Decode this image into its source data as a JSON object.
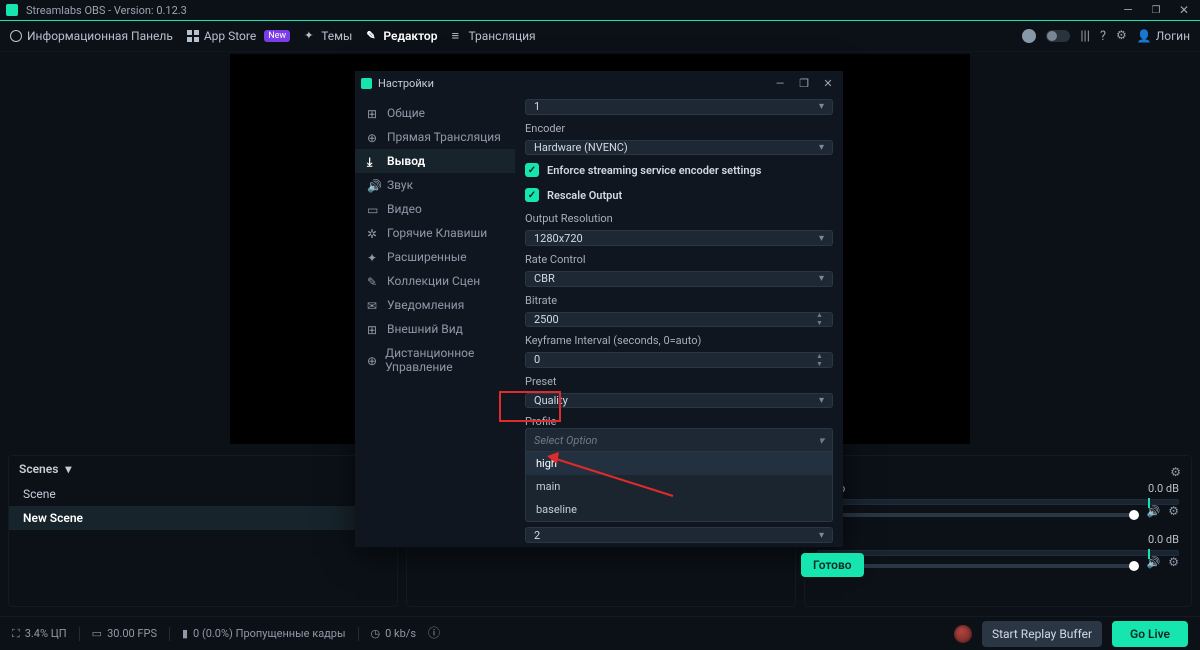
{
  "titlebar": {
    "app_name": "Streamlabs OBS - Version: 0.12.3"
  },
  "topnav": {
    "items": [
      {
        "label": "Информационная Панель",
        "icon": "dashboard-icon"
      },
      {
        "label": "App Store",
        "icon": "appstore-icon",
        "badge": "New"
      },
      {
        "label": "Темы",
        "icon": "themes-icon"
      },
      {
        "label": "Редактор",
        "icon": "editor-icon",
        "active": true
      },
      {
        "label": "Трансляция",
        "icon": "broadcast-icon"
      }
    ],
    "right": {
      "login": "Логин"
    }
  },
  "settings": {
    "title": "Настройки",
    "sidebar": [
      {
        "label": "Общие",
        "icon": "general-icon"
      },
      {
        "label": "Прямая Трансляция",
        "icon": "stream-icon"
      },
      {
        "label": "Вывод",
        "icon": "output-icon",
        "active": true
      },
      {
        "label": "Звук",
        "icon": "audio-icon"
      },
      {
        "label": "Видео",
        "icon": "video-icon"
      },
      {
        "label": "Горячие Клавиши",
        "icon": "hotkeys-icon"
      },
      {
        "label": "Расширенные",
        "icon": "advanced-icon"
      },
      {
        "label": "Коллекции Сцен",
        "icon": "collections-icon"
      },
      {
        "label": "Уведомления",
        "icon": "notifications-icon"
      },
      {
        "label": "Внешний Вид",
        "icon": "appearance-icon"
      },
      {
        "label": "Дистанционное Управление",
        "icon": "remote-icon"
      }
    ],
    "form": {
      "track_value": "1",
      "encoder_label": "Encoder",
      "encoder_value": "Hardware (NVENC)",
      "enforce_label": "Enforce streaming service encoder settings",
      "rescale_label": "Rescale Output",
      "resolution_label": "Output Resolution",
      "resolution_value": "1280x720",
      "ratecontrol_label": "Rate Control",
      "ratecontrol_value": "CBR",
      "bitrate_label": "Bitrate",
      "bitrate_value": "2500",
      "keyframe_label": "Keyframe Interval (seconds, 0=auto)",
      "keyframe_value": "0",
      "preset_label": "Preset",
      "preset_value": "Quality",
      "profile_label": "Profile",
      "profile_placeholder": "Select Option",
      "profile_options": [
        "high",
        "main",
        "baseline"
      ],
      "last_value": "2"
    },
    "done_button": "Готово"
  },
  "scenes_panel": {
    "title": "Scenes",
    "items": [
      "Scene",
      "New Scene"
    ],
    "active_index": 1
  },
  "mixer_panel": {
    "tracks": [
      {
        "name": "Audio",
        "level": "0.0 dB"
      },
      {
        "name": "",
        "level": "0.0 dB"
      }
    ]
  },
  "statusbar": {
    "cpu": "3.4% ЦП",
    "fps": "30.00 FPS",
    "dropped": "0 (0.0%) Пропущенные кадры",
    "bitrate": "0 kb/s",
    "replay_button": "Start Replay Buffer",
    "golive_button": "Go Live"
  }
}
